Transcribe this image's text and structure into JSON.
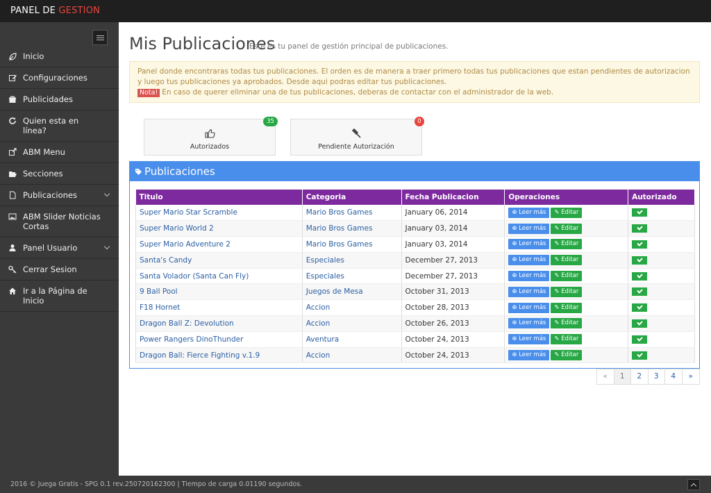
{
  "topbar": {
    "brand_prefix": "PANEL DE ",
    "brand_accent": "GESTION",
    "accent_color": "#e8453c"
  },
  "sidebar": {
    "items": [
      {
        "label": "Inicio",
        "icon": "leaf-icon"
      },
      {
        "label": "Configuraciones",
        "icon": "edit-icon"
      },
      {
        "label": "Publicidades",
        "icon": "gift-icon"
      },
      {
        "label": "Quien esta en línea?",
        "icon": "refresh-icon"
      },
      {
        "label": "ABM Menu",
        "icon": "external-link-icon"
      },
      {
        "label": "Secciones",
        "icon": "folder-open-icon"
      },
      {
        "label": "Publicaciones",
        "icon": "file-icon",
        "expandable": true
      },
      {
        "label": "ABM Slider Noticias Cortas",
        "icon": "image-icon"
      },
      {
        "label": "Panel Usuario",
        "icon": "user-icon",
        "expandable": true
      },
      {
        "label": "Cerrar Sesion",
        "icon": "key-icon"
      },
      {
        "label": "Ir a la Página de Inicio",
        "icon": "home-icon"
      }
    ]
  },
  "header": {
    "title": "Mis Publicaciones",
    "subtitle": "Este es tu panel de gestión principal de publicaciones."
  },
  "alert": {
    "text": "Panel donde encontraras todas tus publicaciones. El orden es de manera a traer primero todas tus publicaciones que estan pendientes de autorizacion y luego tus publicaciones ya aprobados. Desde aqui podras editar tus publicaciones.",
    "note_label": "Nota!",
    "note_text": "En caso de querer eliminar una de tus publicaciones, deberas de contactar con el administrador de la web."
  },
  "stats": [
    {
      "label": "Autorizados",
      "count": "35",
      "icon": "thumbs-up-icon",
      "badge_color": "#28a745"
    },
    {
      "label": "Pendiente Autorización",
      "count": "0",
      "icon": "gavel-icon",
      "badge_color": "#e8453c"
    }
  ],
  "panel": {
    "title": "Publicaciones",
    "headers": [
      "Titulo",
      "Categoria",
      "Fecha Publicacion",
      "Operaciones",
      "Autorizado"
    ],
    "read_label": "Leer más",
    "edit_label": "Editar",
    "rows": [
      {
        "title": "Super Mario Star Scramble",
        "category": "Mario Bros Games",
        "date": "January 06, 2014"
      },
      {
        "title": "Super Mario World 2",
        "category": "Mario Bros Games",
        "date": "January 03, 2014"
      },
      {
        "title": "Super Mario Adventure 2",
        "category": "Mario Bros Games",
        "date": "January 03, 2014"
      },
      {
        "title": "Santa's Candy",
        "category": "Especiales",
        "date": "December 27, 2013"
      },
      {
        "title": "Santa Volador (Santa Can Fly)",
        "category": "Especiales",
        "date": "December 27, 2013"
      },
      {
        "title": "9 Ball Pool",
        "category": "Juegos de Mesa",
        "date": "October 31, 2013"
      },
      {
        "title": "F18 Hornet",
        "category": "Accion",
        "date": "October 28, 2013"
      },
      {
        "title": "Dragon Ball Z: Devolution",
        "category": "Accion",
        "date": "October 26, 2013"
      },
      {
        "title": "Power Rangers DinoThunder",
        "category": "Aventura",
        "date": "October 24, 2013"
      },
      {
        "title": "Dragon Ball: Fierce Fighting v.1.9",
        "category": "Accion",
        "date": "October 24, 2013"
      }
    ]
  },
  "pagination": {
    "prev": "«",
    "pages": [
      "1",
      "2",
      "3",
      "4"
    ],
    "next": "»",
    "current": "1"
  },
  "footer": {
    "text": "2016 © Juega Gratis - SPG 0.1 rev.250720162300 | Tiempo de carga 0.01190 segundos."
  }
}
